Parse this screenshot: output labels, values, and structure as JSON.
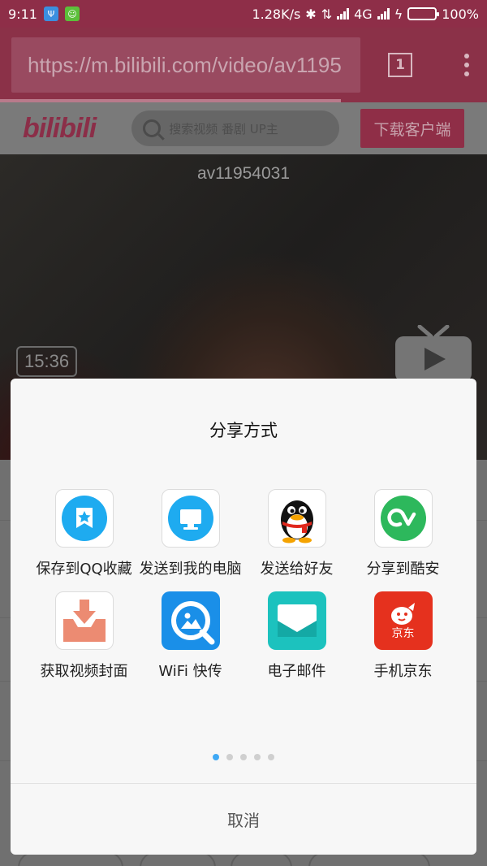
{
  "status_bar": {
    "time": "9:11",
    "network_speed": "1.28K/s",
    "network_type": "4G",
    "battery": "100%",
    "battery_level": 1.0
  },
  "browser": {
    "url": "https://m.bilibili.com/video/av1195",
    "tab_count": "1"
  },
  "site": {
    "logo": "bilibili",
    "search_placeholder": "搜索视频 番剧 UP主",
    "download_button": "下载客户端"
  },
  "video": {
    "title": "av11954031",
    "duration": "15:36"
  },
  "share_sheet": {
    "title": "分享方式",
    "items": [
      {
        "label": "保存到QQ收藏",
        "icon": "qq-favorites-icon"
      },
      {
        "label": "发送到我的电脑",
        "icon": "my-computer-icon"
      },
      {
        "label": "发送给好友",
        "icon": "qq-penguin-icon"
      },
      {
        "label": "分享到酷安",
        "icon": "coolapk-icon"
      },
      {
        "label": "获取视频封面",
        "icon": "download-cover-icon"
      },
      {
        "label": "WiFi 快传",
        "icon": "wifi-transfer-icon"
      },
      {
        "label": "电子邮件",
        "icon": "email-icon"
      },
      {
        "label": "手机京东",
        "icon": "jd-icon",
        "icon_text": "京东"
      }
    ],
    "page_count": 5,
    "current_page": 1,
    "cancel": "取消"
  },
  "colors": {
    "status_bar_bg": "#8e2e48",
    "bilibili_pink": "#fb7299",
    "active_dot": "#3fa9f5"
  }
}
